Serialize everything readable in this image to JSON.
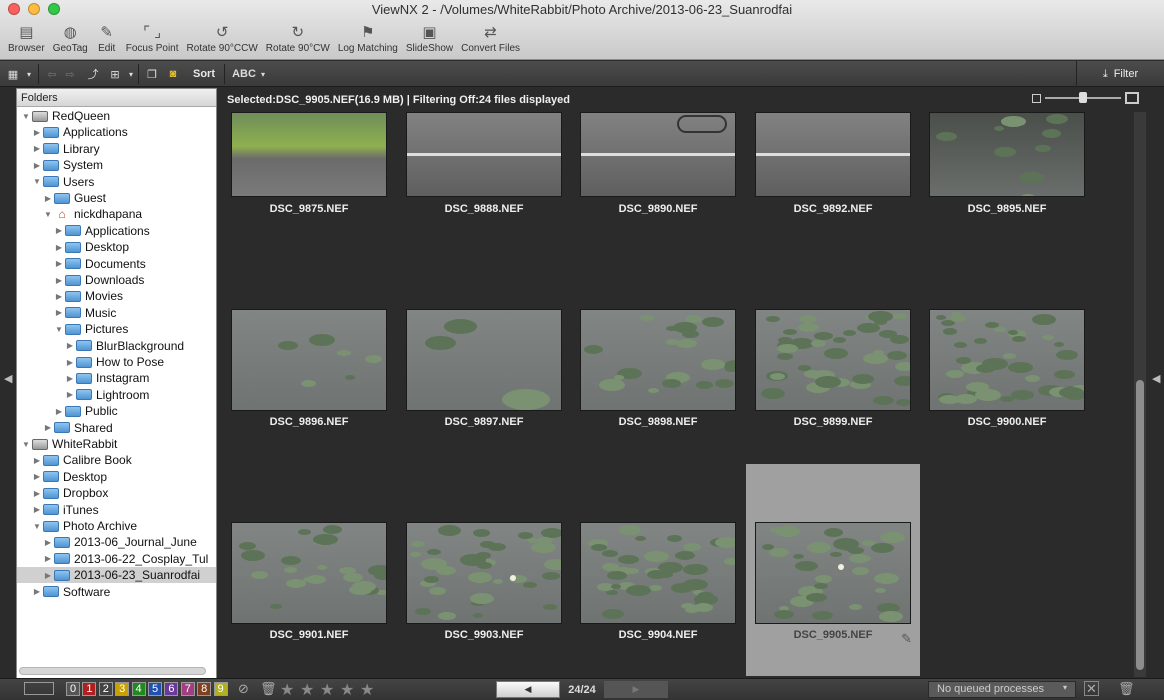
{
  "window": {
    "title": "ViewNX 2 - /Volumes/WhiteRabbit/Photo Archive/2013-06-23_Suanrodfai"
  },
  "toolbar": [
    {
      "label": "Browser",
      "icon": "browser-icon"
    },
    {
      "label": "GeoTag",
      "icon": "geotag-icon"
    },
    {
      "label": "Edit",
      "icon": "edit-icon"
    },
    {
      "label": "Focus Point",
      "icon": "focus-point-icon"
    },
    {
      "label": "Rotate 90°CCW",
      "icon": "rotate-ccw-icon"
    },
    {
      "label": "Rotate 90°CW",
      "icon": "rotate-cw-icon"
    },
    {
      "label": "Log Matching",
      "icon": "log-matching-icon"
    },
    {
      "label": "SlideShow",
      "icon": "slideshow-icon"
    },
    {
      "label": "Convert Files",
      "icon": "convert-files-icon"
    }
  ],
  "toolbar2": {
    "sort_label": "Sort",
    "abc_label": "ABC",
    "filter_label": "Filter"
  },
  "folders": {
    "header": "Folders",
    "items": [
      {
        "label": "RedQueen",
        "depth": 0,
        "expanded": true,
        "type": "drive"
      },
      {
        "label": "Applications",
        "depth": 1,
        "expanded": false,
        "type": "folder"
      },
      {
        "label": "Library",
        "depth": 1,
        "expanded": false,
        "type": "folder"
      },
      {
        "label": "System",
        "depth": 1,
        "expanded": false,
        "type": "folder"
      },
      {
        "label": "Users",
        "depth": 1,
        "expanded": true,
        "type": "folder"
      },
      {
        "label": "Guest",
        "depth": 2,
        "expanded": false,
        "type": "folder"
      },
      {
        "label": "nickdhapana",
        "depth": 2,
        "expanded": true,
        "type": "home"
      },
      {
        "label": "Applications",
        "depth": 3,
        "expanded": false,
        "type": "folder"
      },
      {
        "label": "Desktop",
        "depth": 3,
        "expanded": false,
        "type": "folder"
      },
      {
        "label": "Documents",
        "depth": 3,
        "expanded": false,
        "type": "folder"
      },
      {
        "label": "Downloads",
        "depth": 3,
        "expanded": false,
        "type": "folder"
      },
      {
        "label": "Movies",
        "depth": 3,
        "expanded": false,
        "type": "folder"
      },
      {
        "label": "Music",
        "depth": 3,
        "expanded": false,
        "type": "folder"
      },
      {
        "label": "Pictures",
        "depth": 3,
        "expanded": true,
        "type": "folder"
      },
      {
        "label": "BlurBlackground",
        "depth": 4,
        "expanded": false,
        "type": "folder"
      },
      {
        "label": "How to Pose",
        "depth": 4,
        "expanded": false,
        "type": "folder"
      },
      {
        "label": "Instagram",
        "depth": 4,
        "expanded": false,
        "type": "folder"
      },
      {
        "label": "Lightroom",
        "depth": 4,
        "expanded": false,
        "type": "folder"
      },
      {
        "label": "Public",
        "depth": 3,
        "expanded": false,
        "type": "folder"
      },
      {
        "label": "Shared",
        "depth": 2,
        "expanded": false,
        "type": "folder"
      },
      {
        "label": "WhiteRabbit",
        "depth": 0,
        "expanded": true,
        "type": "drive"
      },
      {
        "label": "Calibre Book",
        "depth": 1,
        "expanded": false,
        "type": "folder"
      },
      {
        "label": "Desktop",
        "depth": 1,
        "expanded": false,
        "type": "folder"
      },
      {
        "label": "Dropbox",
        "depth": 1,
        "expanded": false,
        "type": "folder"
      },
      {
        "label": "iTunes",
        "depth": 1,
        "expanded": false,
        "type": "folder"
      },
      {
        "label": "Photo Archive",
        "depth": 1,
        "expanded": true,
        "type": "folder"
      },
      {
        "label": "2013-06_Journal_June",
        "depth": 2,
        "expanded": false,
        "type": "folder"
      },
      {
        "label": "2013-06-22_Cosplay_Tul",
        "depth": 2,
        "expanded": false,
        "type": "folder"
      },
      {
        "label": "2013-06-23_Suanrodfai",
        "depth": 2,
        "expanded": false,
        "type": "folder",
        "selected": true
      },
      {
        "label": "Software",
        "depth": 1,
        "expanded": false,
        "type": "folder"
      }
    ]
  },
  "status": {
    "text": "Selected:DSC_9905.NEF(16.9 MB) | Filtering Off:24 files displayed"
  },
  "thumbnails": [
    {
      "name": "DSC_9875.NEF",
      "scene": "park"
    },
    {
      "name": "DSC_9888.NEF",
      "scene": "road"
    },
    {
      "name": "DSC_9890.NEF",
      "scene": "road-bike"
    },
    {
      "name": "DSC_9892.NEF",
      "scene": "road"
    },
    {
      "name": "DSC_9895.NEF",
      "scene": "pond-dark"
    },
    {
      "name": "DSC_9896.NEF",
      "scene": "pond-sparse"
    },
    {
      "name": "DSC_9897.NEF",
      "scene": "pond-few"
    },
    {
      "name": "DSC_9898.NEF",
      "scene": "pond"
    },
    {
      "name": "DSC_9899.NEF",
      "scene": "pond-dense"
    },
    {
      "name": "DSC_9900.NEF",
      "scene": "pond-dense"
    },
    {
      "name": "DSC_9901.NEF",
      "scene": "pond"
    },
    {
      "name": "DSC_9903.NEF",
      "scene": "pond-flower"
    },
    {
      "name": "DSC_9904.NEF",
      "scene": "pond-dense"
    },
    {
      "name": "DSC_9905.NEF",
      "scene": "pond-flower",
      "selected": true
    }
  ],
  "bottom": {
    "labels": [
      "0",
      "1",
      "2",
      "3",
      "4",
      "5",
      "6",
      "7",
      "8",
      "9"
    ],
    "label_colors": [
      "#555555",
      "#b02020",
      "#444444",
      "#c8a000",
      "#208a20",
      "#2050b0",
      "#6a3a9a",
      "#a04080",
      "#804020",
      "#b0b020"
    ],
    "stars": 5,
    "page": "24/24",
    "queue_text": "No queued processes"
  }
}
